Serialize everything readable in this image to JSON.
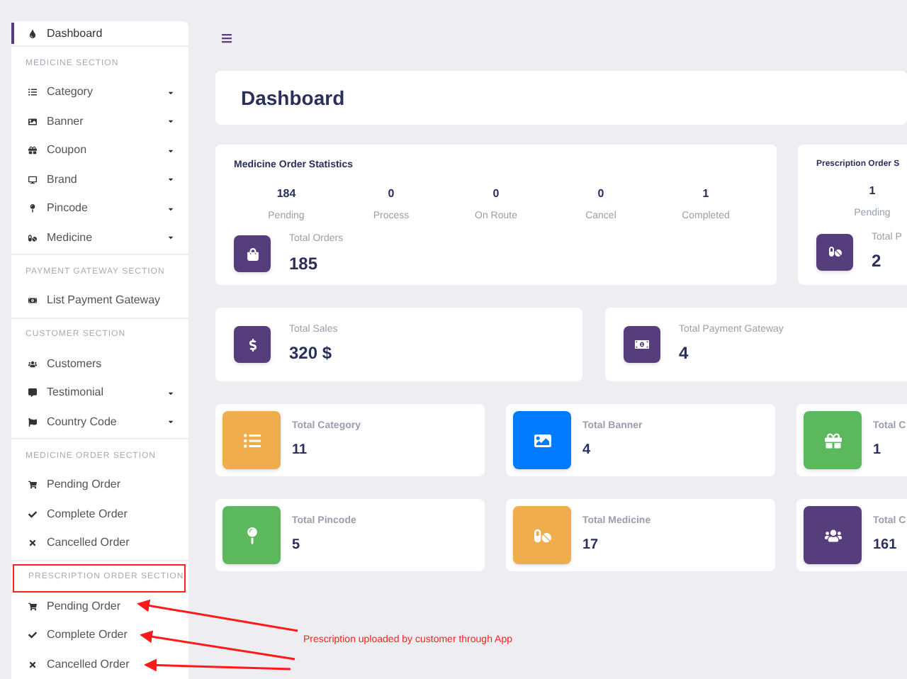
{
  "sidebar": {
    "dashboard": {
      "label": "Dashboard",
      "selected": true
    },
    "sections": [
      {
        "title": "MEDICINE SECTION",
        "highlighted": false,
        "items": [
          {
            "label": "Category",
            "selected": false,
            "caret": true
          },
          {
            "label": "Banner",
            "selected": false,
            "caret": true
          },
          {
            "label": "Coupon",
            "selected": false,
            "caret": true
          },
          {
            "label": "Brand",
            "selected": false,
            "caret": true
          },
          {
            "label": "Pincode",
            "selected": false,
            "caret": true
          },
          {
            "label": "Medicine",
            "selected": false,
            "caret": true
          }
        ]
      },
      {
        "title": "PAYMENT GATEWAY SECTION",
        "highlighted": false,
        "items": [
          {
            "label": "List Payment Gateway",
            "selected": false,
            "caret": false
          }
        ]
      },
      {
        "title": "CUSTOMER SECTION",
        "highlighted": false,
        "items": [
          {
            "label": "Customers",
            "selected": false,
            "caret": false
          },
          {
            "label": "Testimonial",
            "selected": false,
            "caret": true
          },
          {
            "label": "Country Code",
            "selected": false,
            "caret": true
          }
        ]
      },
      {
        "title": "MEDICINE ORDER SECTION",
        "highlighted": false,
        "items": [
          {
            "label": "Pending Order",
            "selected": false,
            "caret": false
          },
          {
            "label": "Complete Order",
            "selected": false,
            "caret": false
          },
          {
            "label": "Cancelled Order",
            "selected": false,
            "caret": false
          }
        ]
      },
      {
        "title": "PRESCRIPTION ORDER SECTION",
        "highlighted": true,
        "items": [
          {
            "label": "Pending Order",
            "selected": false,
            "caret": false
          },
          {
            "label": "Complete Order",
            "selected": false,
            "caret": false
          },
          {
            "label": "Cancelled Order",
            "selected": false,
            "caret": false
          }
        ]
      }
    ]
  },
  "header": {
    "title": "Dashboard"
  },
  "order_stats": [
    {
      "title": "Medicine Order Statistics",
      "stats": [
        {
          "value": "184",
          "label": "Pending"
        },
        {
          "value": "0",
          "label": "Process"
        },
        {
          "value": "0",
          "label": "On Route"
        },
        {
          "value": "0",
          "label": "Cancel"
        },
        {
          "value": "1",
          "label": "Completed"
        }
      ],
      "total": {
        "label": "Total Orders",
        "value": "185"
      }
    },
    {
      "title": "Prescription Order S",
      "stats": [
        {
          "value": "1",
          "label": "Pending"
        }
      ],
      "total": {
        "label": "Total P",
        "value": "2"
      }
    }
  ],
  "summary": [
    {
      "label": "Total Sales",
      "value": "320 $"
    },
    {
      "label": "Total Payment Gateway",
      "value": "4"
    }
  ],
  "tiles": [
    {
      "label": "Total Category",
      "value": "11",
      "color": "#f0ad4e"
    },
    {
      "label": "Total Banner",
      "value": "4",
      "color": "#007bff"
    },
    {
      "label": "Total C",
      "value": "1",
      "color": "#5cb85c"
    },
    {
      "label": "Total Pincode",
      "value": "5",
      "color": "#5cb85c"
    },
    {
      "label": "Total Medicine",
      "value": "17",
      "color": "#f0ad4e"
    },
    {
      "label": "Total C",
      "value": "161",
      "color": "#563d7c"
    }
  ],
  "annotation": {
    "text": "Prescription uploaded by customer through App"
  }
}
